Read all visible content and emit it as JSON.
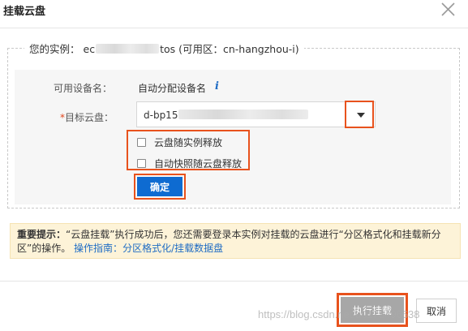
{
  "dialog": {
    "title": "挂载云盘"
  },
  "instance": {
    "label": "您的实例：",
    "id_prefix": "ec",
    "id_suffix": "tos",
    "zone": "(可用区：cn-hangzhou-i)"
  },
  "form": {
    "device_label": "可用设备名：",
    "device_value": "自动分配设备名",
    "required_mark": "*",
    "disk_label": "目标云盘：",
    "disk_value_prefix": "d-bp15"
  },
  "options": {
    "release_with_instance": "云盘随实例释放",
    "release_snapshot": "自动快照随云盘释放"
  },
  "buttons": {
    "ok": "确定",
    "execute": "执行挂载",
    "cancel": "取消"
  },
  "notice": {
    "title": "重要提示：",
    "text": "“云盘挂载”执行成功后，您还需要登录本实例对挂载的云盘进行“分区格式化和挂载新分区”的操作。",
    "guide_label": "操作指南：",
    "guide_link": "分区格式化/挂载数据盘"
  },
  "watermark": "https://blog.csdn.net/u0178496638",
  "colors": {
    "primary": "#0e6bd1",
    "highlight": "#e8521d",
    "link": "#1f6cc4",
    "notice_bg": "#fdf3d8",
    "disabled_btn": "#a7a7a7"
  },
  "icons": {
    "close": "close-icon",
    "info": "info-icon",
    "caret": "caret-down-icon"
  }
}
